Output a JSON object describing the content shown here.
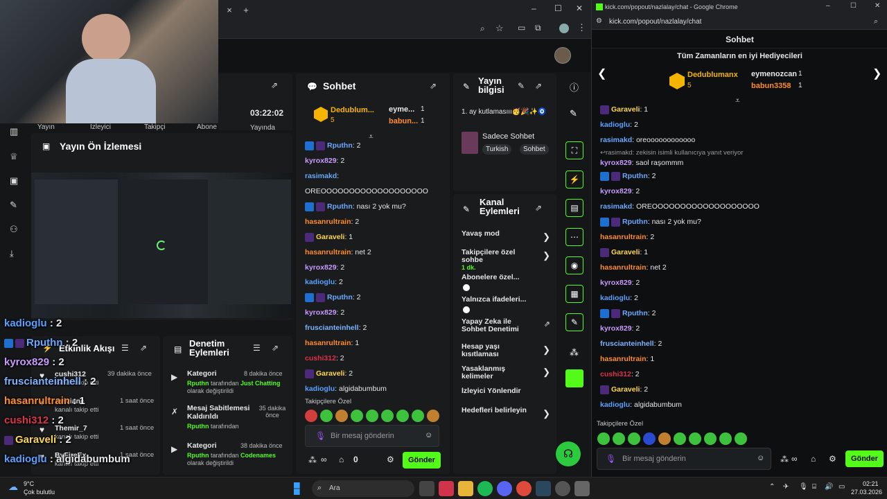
{
  "left_browser": {
    "tab_new": "+",
    "tab_close": "×",
    "win_controls": [
      "–",
      "☐",
      "✕"
    ]
  },
  "stats": {
    "time_value": "03:22:02",
    "labels": [
      "Yayın",
      "İzleyici",
      "Takipçi",
      "Abone",
      "Yayında"
    ]
  },
  "preview": {
    "title": "Yayın Ön İzlemesi"
  },
  "activity": {
    "title": "Etkinlik Akışı",
    "items": [
      {
        "user": "cushi312",
        "sub": "kanalı takip etti",
        "time": "39 dakika önce"
      },
      {
        "user": "Aviviane",
        "sub": "kanalı takip etti",
        "time": "1 saat önce"
      },
      {
        "user": "Themir_7",
        "sub": "kanalı takip etti",
        "time": "1 saat önce"
      },
      {
        "user": "ByFireEx",
        "sub": "kanalı takip etti",
        "time": "1 saat önce"
      }
    ]
  },
  "mod_actions": {
    "title_line1": "Denetim",
    "title_line2": "Eylemleri",
    "items": [
      {
        "title": "Kategori",
        "time": "8 dakika önce",
        "actor": "Rputhn",
        "mid": " tarafından ",
        "target": "Just Chatting",
        "tail": " olarak değiştirildi"
      },
      {
        "title": "Mesaj Sabitlemesi Kaldırıldı",
        "time": "35 dakika önce",
        "actor": "Rputhn",
        "mid": " tarafından",
        "target": "",
        "tail": ""
      },
      {
        "title": "Kategori",
        "time": "38 dakika önce",
        "actor": "Rputhn",
        "mid": " tarafından ",
        "target": "Codenames",
        "tail": " olarak değiştirildi"
      }
    ]
  },
  "chat": {
    "title": "Sohbet",
    "gifter1": "Dedublum...",
    "gifter1_count": "5",
    "gifter2": "eyme...",
    "gifter2_count": "1",
    "gifter3": "babun...",
    "gifter3_count": "1",
    "messages": [
      {
        "user": "Rputhn",
        "color": "#6aa8ff",
        "text": ": 2",
        "badges": 2
      },
      {
        "user": "kyrox829",
        "color": "#c89bff",
        "text": ": 2",
        "badges": 0
      },
      {
        "user": "rasimakd",
        "color": "#6aa8ff",
        "text": ":",
        "badges": 0
      },
      {
        "user": "",
        "color": "#fff",
        "text": "OREOOOOOOOOOOOOOOOOOOO",
        "badges": 0
      },
      {
        "user": "Rputhn",
        "color": "#6aa8ff",
        "text": ": nası 2 yok mu?",
        "badges": 2
      },
      {
        "user": "hasanrultrain",
        "color": "#ff8c2a",
        "text": ": 2",
        "badges": 0
      },
      {
        "user": "Garaveli",
        "color": "#ffd84a",
        "text": ": 1",
        "badges": 1
      },
      {
        "user": "hasanrultrain",
        "color": "#ff8c2a",
        "text": ": net 2",
        "badges": 0
      },
      {
        "user": "kyrox829",
        "color": "#c89bff",
        "text": ": 2",
        "badges": 0
      },
      {
        "user": "kadioglu",
        "color": "#5aa0ff",
        "text": ": 2",
        "badges": 0
      },
      {
        "user": "Rputhn",
        "color": "#6aa8ff",
        "text": ": 2",
        "badges": 2
      },
      {
        "user": "kyrox829",
        "color": "#c89bff",
        "text": ": 2",
        "badges": 0
      },
      {
        "user": "fruscianteinhell",
        "color": "#7fb2ff",
        "text": ": 2",
        "badges": 0
      },
      {
        "user": "hasanrultrain",
        "color": "#ff8c2a",
        "text": ": 1",
        "badges": 0
      },
      {
        "user": "cushi312",
        "color": "#e0304a",
        "text": ": 2",
        "badges": 0
      },
      {
        "user": "Garaveli",
        "color": "#ffd84a",
        "text": ": 2",
        "badges": 1
      },
      {
        "user": "kadioglu",
        "color": "#5aa0ff",
        "text": ": algidabumbum",
        "badges": 0
      }
    ],
    "followers_only": "Takipçilere Özel",
    "input_placeholder": "Bir mesaj gönderin",
    "count": "0",
    "send": "Gönder"
  },
  "stream_info": {
    "title_line1": "Yayın",
    "title_line2": "bilgisi",
    "text": "1. ay kutlamasııı🥳🎉✨🧿",
    "category": "Sadece Sohbet",
    "tags": [
      "Turkish",
      "Sohbet"
    ]
  },
  "channel_actions": {
    "title_line1": "Kanal",
    "title_line2": "Eylemleri",
    "items": [
      {
        "label": "Yavaş mod",
        "sub": "",
        "control": "chevron"
      },
      {
        "label": "Takipçilere özel sohbe",
        "sub": "1 dk.",
        "control": "chevron"
      },
      {
        "label": "Abonelere özel...",
        "sub": "",
        "control": "toggle"
      },
      {
        "label": "Yalnızca ifadeleri...",
        "sub": "",
        "control": "toggle"
      },
      {
        "label": "Yapay Zeka ile Sohbet Denetimi",
        "sub": "",
        "control": "external"
      },
      {
        "label": "Hesap yaşı kısıtlaması",
        "sub": "",
        "control": "chevron"
      },
      {
        "label": "Yasaklanmış kelimeler",
        "sub": "",
        "control": "chevron"
      },
      {
        "label": "İzleyici Yönlendir",
        "sub": "",
        "control": "none"
      },
      {
        "label": "Hedefleri belirleyin",
        "sub": "",
        "control": "chevron"
      }
    ]
  },
  "overlay_chat": [
    {
      "user": "kadioglu",
      "color": "#5aa0ff",
      "text": " : 2"
    },
    {
      "user": "Rputhn",
      "color": "#6aa8ff",
      "text": " : 2"
    },
    {
      "user": "kyrox829",
      "color": "#c89bff",
      "text": " : 2"
    },
    {
      "user": "fruscianteinhell",
      "color": "#7fb2ff",
      "text": " : 2"
    },
    {
      "user": "hasanrultrain",
      "color": "#ff8c2a",
      "text": " : 1"
    },
    {
      "user": "cushi312",
      "color": "#e0304a",
      "text": " : 2"
    },
    {
      "user": "Garaveli",
      "color": "#ffd84a",
      "text": " : 2"
    },
    {
      "user": "kadioglu",
      "color": "#5aa0ff",
      "text": " : algidabumbum"
    }
  ],
  "right_browser": {
    "title": "kick.com/popout/nazlalay/chat - Google Chrome",
    "url": "kick.com/popout/nazlalay/chat",
    "chat_title": "Sohbet",
    "top_gifters_title": "Tüm Zamanların en iyi Hediyecileri",
    "gifter1": "Dedublumanx",
    "gifter1_count": "5",
    "gifter2": "eymenozcan",
    "gifter2_count": "1",
    "gifter3": "babun3358",
    "gifter3_count": "1",
    "reply_note": "rasimakd: zekisin isimli kullanıcıya yanıt veriyor",
    "messages": [
      {
        "user": "Garaveli",
        "color": "#ffd84a",
        "text": ": 1",
        "badges": 1
      },
      {
        "user": "kadioglu",
        "color": "#5aa0ff",
        "text": ": 2",
        "badges": 0
      },
      {
        "user": "rasimakd",
        "color": "#6aa8ff",
        "text": ": oreoooooooooooo",
        "badges": 0
      },
      {
        "user": "kyrox829",
        "color": "#c89bff",
        "text": ": saol raşommm",
        "badges": 0
      },
      {
        "user": "Rputhn",
        "color": "#6aa8ff",
        "text": ": 2",
        "badges": 2
      },
      {
        "user": "kyrox829",
        "color": "#c89bff",
        "text": ": 2",
        "badges": 0
      },
      {
        "user": "rasimakd",
        "color": "#6aa8ff",
        "text": ": OREOOOOOOOOOOOOOOOOOOO",
        "badges": 0
      },
      {
        "user": "Rputhn",
        "color": "#6aa8ff",
        "text": ": nası 2 yok mu?",
        "badges": 2
      },
      {
        "user": "hasanrultrain",
        "color": "#ff8c2a",
        "text": ": 2",
        "badges": 0
      },
      {
        "user": "Garaveli",
        "color": "#ffd84a",
        "text": ": 1",
        "badges": 1
      },
      {
        "user": "hasanrultrain",
        "color": "#ff8c2a",
        "text": ": net 2",
        "badges": 0
      },
      {
        "user": "kyrox829",
        "color": "#c89bff",
        "text": ": 2",
        "badges": 0
      },
      {
        "user": "kadioglu",
        "color": "#5aa0ff",
        "text": ": 2",
        "badges": 0
      },
      {
        "user": "Rputhn",
        "color": "#6aa8ff",
        "text": ": 2",
        "badges": 2
      },
      {
        "user": "kyrox829",
        "color": "#c89bff",
        "text": ": 2",
        "badges": 0
      },
      {
        "user": "fruscianteinhell",
        "color": "#7fb2ff",
        "text": ": 2",
        "badges": 0
      },
      {
        "user": "hasanrultrain",
        "color": "#ff8c2a",
        "text": ": 1",
        "badges": 0
      },
      {
        "user": "cushi312",
        "color": "#e0304a",
        "text": ": 2",
        "badges": 0
      },
      {
        "user": "Garaveli",
        "color": "#ffd84a",
        "text": ": 2",
        "badges": 1
      },
      {
        "user": "kadioglu",
        "color": "#5aa0ff",
        "text": ": algidabumbum",
        "badges": 0
      }
    ],
    "followers_only": "Takipçilere Özel",
    "input_placeholder": "Bir mesaj gönderin",
    "send": "Gönder"
  },
  "taskbar": {
    "weather_temp": "9°C",
    "weather_desc": "Çok bulutlu",
    "search": "Ara",
    "time": "02:21",
    "date": "27.03.2026"
  },
  "colors": {
    "accent": "#53fc18",
    "panel": "#191b1c",
    "bg": "#0b0e0f"
  }
}
